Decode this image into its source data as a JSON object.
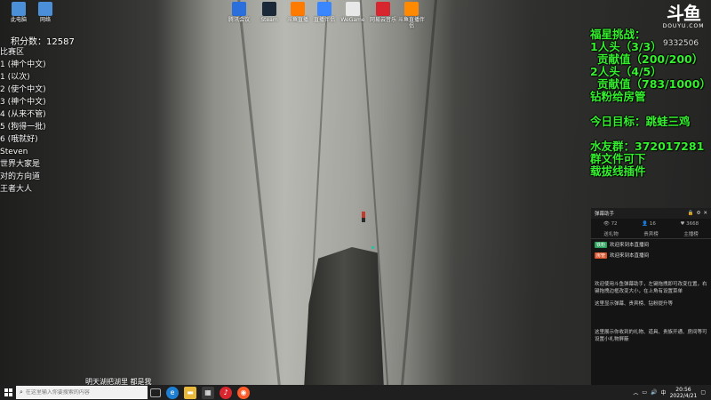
{
  "desktop_icons_top": [
    {
      "label": "此电脑",
      "icon": "computer-icon",
      "color": "#4a8fd8"
    },
    {
      "label": "网络",
      "icon": "network-icon",
      "color": "#4a8fd8"
    },
    {
      "label": "腾讯会议",
      "icon": "meeting-icon",
      "color": "#2a6fdb"
    },
    {
      "label": "Steam",
      "icon": "steam-icon",
      "color": "#1b2838"
    },
    {
      "label": "斗鱼直播",
      "icon": "douyu-icon",
      "color": "#ff7a00"
    },
    {
      "label": "直播伴侣",
      "icon": "companion-icon",
      "color": "#3a86ff"
    },
    {
      "label": "WeGame",
      "icon": "wegame-icon",
      "color": "#e8e8e8"
    },
    {
      "label": "网易云音乐",
      "icon": "music-icon",
      "color": "#d8262f"
    },
    {
      "label": "斗鱼直播伴侣",
      "icon": "douyu-companion-icon",
      "color": "#ff8a00"
    }
  ],
  "left_overlay": {
    "score_label": "积分数：",
    "score_value": "12587",
    "rows": [
      "比赛区",
      "1 (神个中文)",
      "1 (以次)",
      "2 (使个中文)",
      "3 (神个中文)",
      "4 (从来不管)",
      "5 (狗得一批)",
      "6 (哦就好)",
      "Steven",
      "世界大家是",
      "对的方向道",
      "王者大人"
    ]
  },
  "right_overlay": {
    "rows": [
      {
        "text": "福星挑战：",
        "indent": false
      },
      {
        "text": "1人头（3/3）",
        "indent": false
      },
      {
        "text": "贡献值（200/200）",
        "indent": true
      },
      {
        "text": "2人头（4/5）",
        "indent": false
      },
      {
        "text": "贡献值（783/1000）",
        "indent": true
      },
      {
        "text": "钻粉给房管",
        "indent": false
      }
    ],
    "goal": "今日目标：跳蛙三鸡",
    "fans_group": "水友群：372017281",
    "group_files_1": "群文件可下",
    "group_files_2": "载拔线插件"
  },
  "douyu": {
    "logo": "斗鱼",
    "sub": "DOUYU.COM",
    "room_id": "9332506"
  },
  "chat": {
    "title": "弹幕助手",
    "stats": [
      "72",
      "16",
      "3668"
    ],
    "tabs": [
      "送礼物",
      "贵宾榜",
      "主播榜"
    ],
    "messages": [
      {
        "badge": "铁粉",
        "badge_color": "#2aa15a",
        "text": "欢迎来到本直播间"
      },
      {
        "badge": "房管",
        "badge_color": "#d8532a",
        "text": "欢迎来到本直播间"
      }
    ],
    "notice_1": "欢迎使用斗鱼弹幕助手，左键拖拽即可改变位置，右键拖拽边框改变大小，在上角有设置菜单",
    "notice_2": "这里显示弹幕、贵宾榜、钻粉提升等",
    "notice_3": "这里展示你收到的礼物、道具、贵族开通、房间等可设置小礼物屏蔽"
  },
  "caption": "明天湖把湖里 都是我",
  "taskbar": {
    "search_placeholder": "在这里输入你要搜索的内容",
    "time": "20:56",
    "date": "2022/4/21",
    "ime": "中"
  }
}
